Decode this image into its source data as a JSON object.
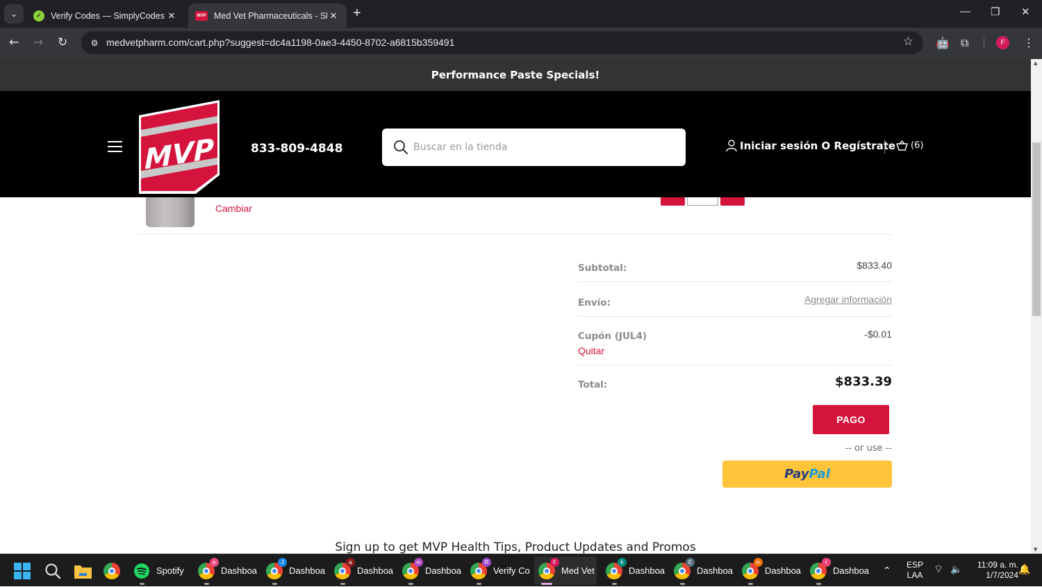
{
  "browser": {
    "tabs": [
      {
        "title": "Verify Codes — SimplyCodes",
        "favicon": "simplycodes-icon",
        "active": false
      },
      {
        "title": "Med Vet Pharmaceuticals - Shop",
        "favicon": "mvp-icon",
        "active": true
      }
    ],
    "url": "medvetpharm.com/cart.php?suggest=dc4a1198-0ae3-4450-8702-a6815b359491",
    "profile_initial": "F",
    "profile_color": "#d31b5b"
  },
  "site": {
    "promo_banner": "Performance Paste Specials!",
    "logo_text": "MVP",
    "phone": "833-809-4848",
    "search": {
      "placeholder": "Buscar en la tienda",
      "value": ""
    },
    "account_label": "Iniciar sesión O Regístrate",
    "cart_count": "(6)",
    "brand_color": "#d4143d"
  },
  "cart_item": {
    "change_label": "Cambiar",
    "quantity": ""
  },
  "totals": {
    "subtotal_label": "Subtotal:",
    "subtotal_value": "$833.40",
    "shipping_label": "Envío:",
    "shipping_value": "Agregar información",
    "coupon_label": "Cupón (JUL4)",
    "coupon_value": "-$0.01",
    "coupon_remove": "Quitar",
    "total_label": "Total:",
    "total_value": "$833.39",
    "checkout_button": "PAGO",
    "or_use": "-- or use --",
    "paypal_part1": "Pay",
    "paypal_part2": "Pal"
  },
  "newsletter_heading": "Sign up to get MVP Health Tips, Product Updates and Promos",
  "taskbar": {
    "items": [
      {
        "label": "Spotify",
        "icon": "spotify-icon"
      },
      {
        "label": "Dashboa",
        "badge": "e",
        "badge_color": "#e64980"
      },
      {
        "label": "Dashboa",
        "badge": "J",
        "badge_color": "#1e88e5"
      },
      {
        "label": "Dashboa",
        "badge": "a",
        "badge_color": "#8b1a1a"
      },
      {
        "label": "Dashboa",
        "badge": "m",
        "badge_color": "#ab47bc"
      },
      {
        "label": "Verify Co",
        "badge": "R",
        "badge_color": "#9c4dcc"
      },
      {
        "label": "Med Vet",
        "badge": "F",
        "badge_color": "#d31b5b",
        "active": true
      },
      {
        "label": "Dashboa",
        "badge": "k",
        "badge_color": "#00897b"
      },
      {
        "label": "Dashboa",
        "badge": "E",
        "badge_color": "#546e7a"
      },
      {
        "label": "Dashboa",
        "badge": "m",
        "badge_color": "#ef6c00"
      },
      {
        "label": "Dashboa",
        "badge": "r",
        "badge_color": "#ec407a"
      }
    ],
    "language_line1": "ESP",
    "language_line2": "LAA",
    "time": "11:09 a. m.",
    "date": "1/7/2024"
  }
}
